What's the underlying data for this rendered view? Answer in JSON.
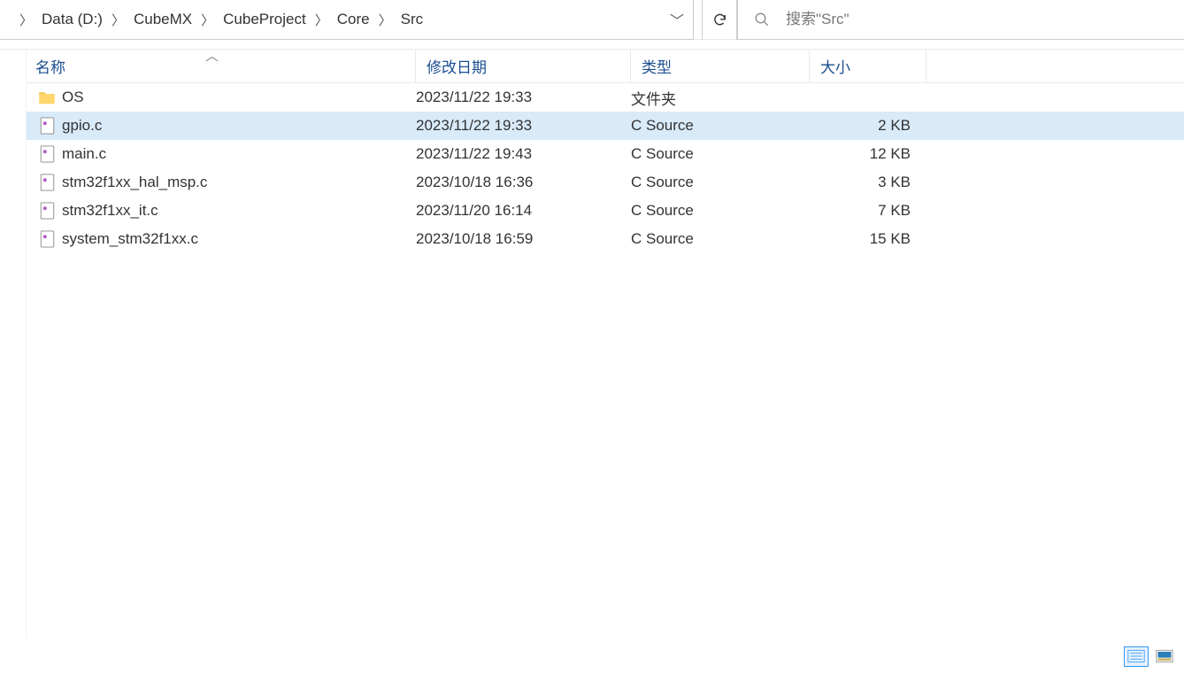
{
  "breadcrumb": [
    "Data (D:)",
    "CubeMX",
    "CubeProject",
    "Core",
    "Src"
  ],
  "search": {
    "placeholder": "搜索\"Src\""
  },
  "columns": {
    "name": "名称",
    "date": "修改日期",
    "type": "类型",
    "size": "大小"
  },
  "files": [
    {
      "name": "OS",
      "date": "2023/11/22 19:33",
      "type": "文件夹",
      "size": "",
      "icon": "folder",
      "selected": false
    },
    {
      "name": "gpio.c",
      "date": "2023/11/22 19:33",
      "type": "C Source",
      "size": "2 KB",
      "icon": "cfile",
      "selected": true
    },
    {
      "name": "main.c",
      "date": "2023/11/22 19:43",
      "type": "C Source",
      "size": "12 KB",
      "icon": "cfile",
      "selected": false
    },
    {
      "name": "stm32f1xx_hal_msp.c",
      "date": "2023/10/18 16:36",
      "type": "C Source",
      "size": "3 KB",
      "icon": "cfile",
      "selected": false
    },
    {
      "name": "stm32f1xx_it.c",
      "date": "2023/11/20 16:14",
      "type": "C Source",
      "size": "7 KB",
      "icon": "cfile",
      "selected": false
    },
    {
      "name": "system_stm32f1xx.c",
      "date": "2023/10/18 16:59",
      "type": "C Source",
      "size": "15 KB",
      "icon": "cfile",
      "selected": false
    }
  ]
}
